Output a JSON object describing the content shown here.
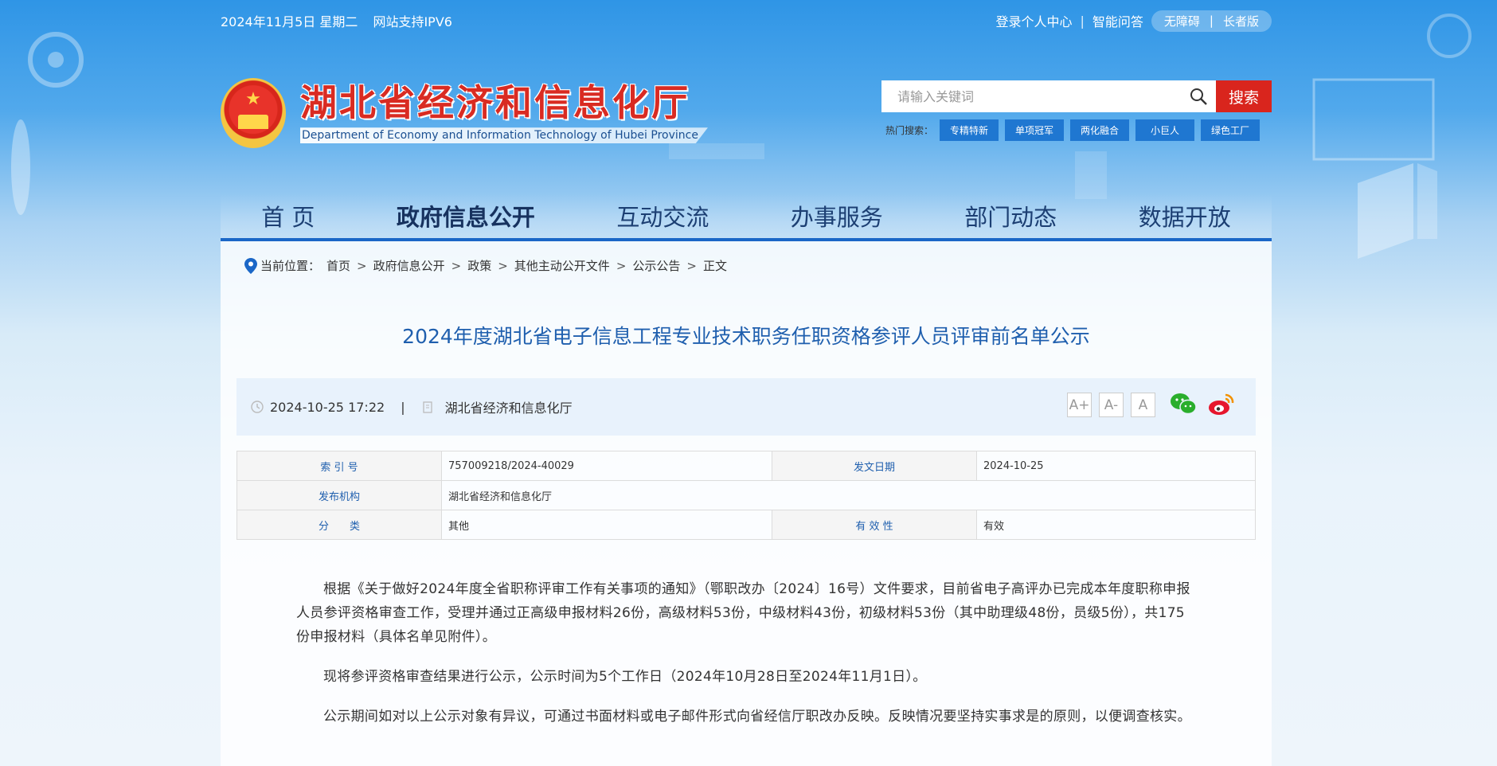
{
  "topbar": {
    "date": "2024年11月5日 星期二",
    "ipv6": "网站支持IPV6",
    "login": "登录个人中心",
    "qa": "智能问答",
    "accessible": "无障碍",
    "elder": "长者版"
  },
  "site": {
    "title_cn": "湖北省经济和信息化厅",
    "title_en": "Department of Economy and Information Technology of Hubei Province"
  },
  "search": {
    "placeholder": "请输入关键词",
    "button": "搜索",
    "hot_label": "热门搜索：",
    "hot_tags": [
      "专精特新",
      "单项冠军",
      "两化融合",
      "小巨人",
      "绿色工厂"
    ]
  },
  "nav": [
    "首 页",
    "政府信息公开",
    "互动交流",
    "办事服务",
    "部门动态",
    "数据开放"
  ],
  "breadcrumb": {
    "label": "当前位置：",
    "items": [
      "首页",
      "政府信息公开",
      "政策",
      "其他主动公开文件",
      "公示公告",
      "正文"
    ],
    "separator": ">"
  },
  "article": {
    "title": "2024年度湖北省电子信息工程专业技术职务任职资格参评人员评审前名单公示",
    "datetime": "2024-10-25 17:22",
    "divider": "|",
    "source": "湖北省经济和信息化厅",
    "font_buttons": [
      "A+",
      "A-",
      "A"
    ],
    "table": {
      "index_label": "索 引 号",
      "index_value": "757009218/2024-40029",
      "date_label": "发文日期",
      "date_value": "2024-10-25",
      "org_label": "发布机构",
      "org_value": "湖北省经济和信息化厅",
      "cat_label": "分　　类",
      "cat_value": "其他",
      "valid_label": "有 效 性",
      "valid_value": "有效"
    },
    "paragraphs": [
      "根据《关于做好2024年度全省职称评审工作有关事项的通知》（鄂职改办〔2024〕16号）文件要求，目前省电子高评办已完成本年度职称申报人员参评资格审查工作，受理并通过正高级申报材料26份，高级材料53份，中级材料43份，初级材料53份（其中助理级48份，员级5份），共175份申报材料（具体名单见附件）。",
      "现将参评资格审查结果进行公示，公示时间为5个工作日（2024年10月28日至2024年11月1日）。",
      "公示期间如对以上公示对象有异议，可通过书面材料或电子邮件形式向省经信厅职改办反映。反映情况要坚持实事求是的原则，以便调查核实。"
    ]
  },
  "colors": {
    "brand_red": "#d92b22",
    "nav_blue": "#1b67c7",
    "title_blue": "#1f5fae"
  }
}
